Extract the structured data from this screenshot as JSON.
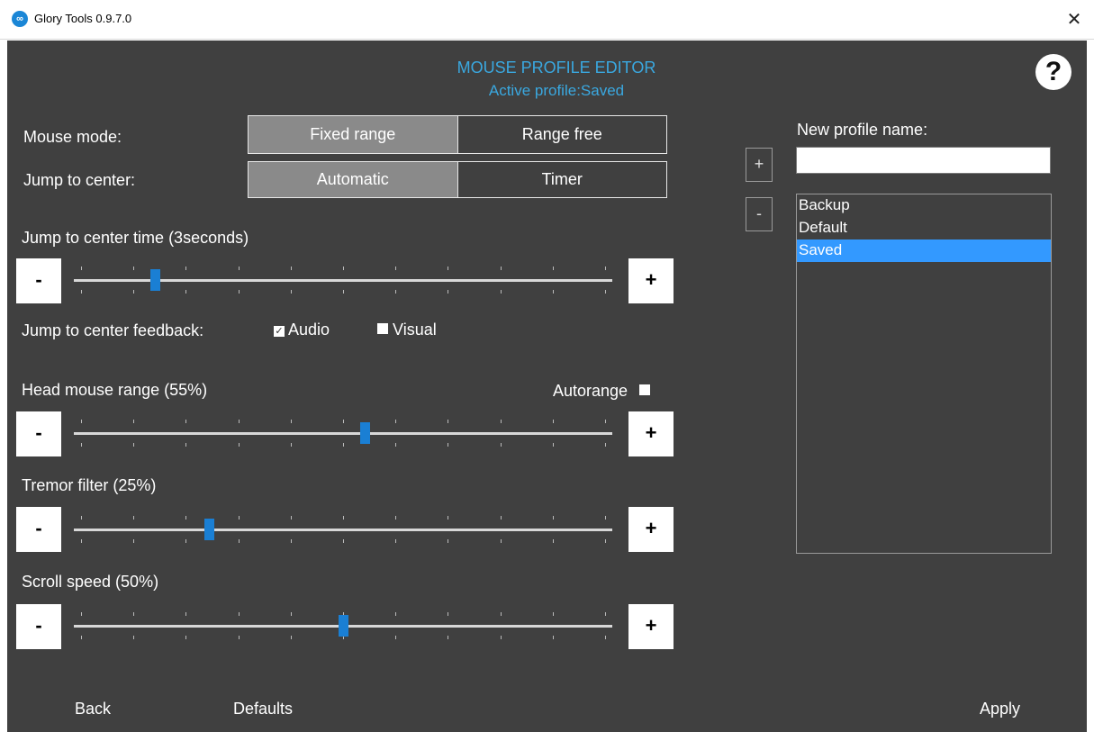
{
  "window": {
    "title": "Glory Tools 0.9.7.0",
    "close_glyph": "✕",
    "app_icon": "app-logo-icon"
  },
  "header": {
    "title": "MOUSE PROFILE EDITOR",
    "subtitle": "Active profile:Saved",
    "help_label": "?",
    "accent_color": "#3aa8e0"
  },
  "mouse_mode": {
    "label": "Mouse mode:",
    "options": [
      "Fixed range",
      "Range free"
    ],
    "selected": "Fixed range"
  },
  "jump_center": {
    "label": "Jump to center:",
    "options": [
      "Automatic",
      "Timer"
    ],
    "selected": "Automatic"
  },
  "sliders": [
    {
      "label": "Jump to center time (3seconds)",
      "value": 0.15,
      "minus": "-",
      "plus": "+"
    },
    {
      "label": "Head mouse range (55%)",
      "value": 0.54,
      "minus": "-",
      "plus": "+"
    },
    {
      "label": "Tremor filter (25%)",
      "value": 0.25,
      "minus": "-",
      "plus": "+"
    },
    {
      "label": "Scroll speed (50%)",
      "value": 0.5,
      "minus": "-",
      "plus": "+"
    }
  ],
  "feedback": {
    "label": "Jump to center feedback:",
    "audio": {
      "label": "Audio",
      "checked": true
    },
    "visual": {
      "label": "Visual",
      "checked": false
    }
  },
  "autorange": {
    "label": "Autorange",
    "checked": false
  },
  "profiles": {
    "new_name_label": "New profile name:",
    "new_name_value": "",
    "add_label": "+",
    "remove_label": "-",
    "items": [
      "Backup",
      "Default",
      "Saved"
    ],
    "selected": "Saved",
    "selected_color": "#3399ff"
  },
  "footer": {
    "back": "Back",
    "defaults": "Defaults",
    "apply": "Apply"
  }
}
